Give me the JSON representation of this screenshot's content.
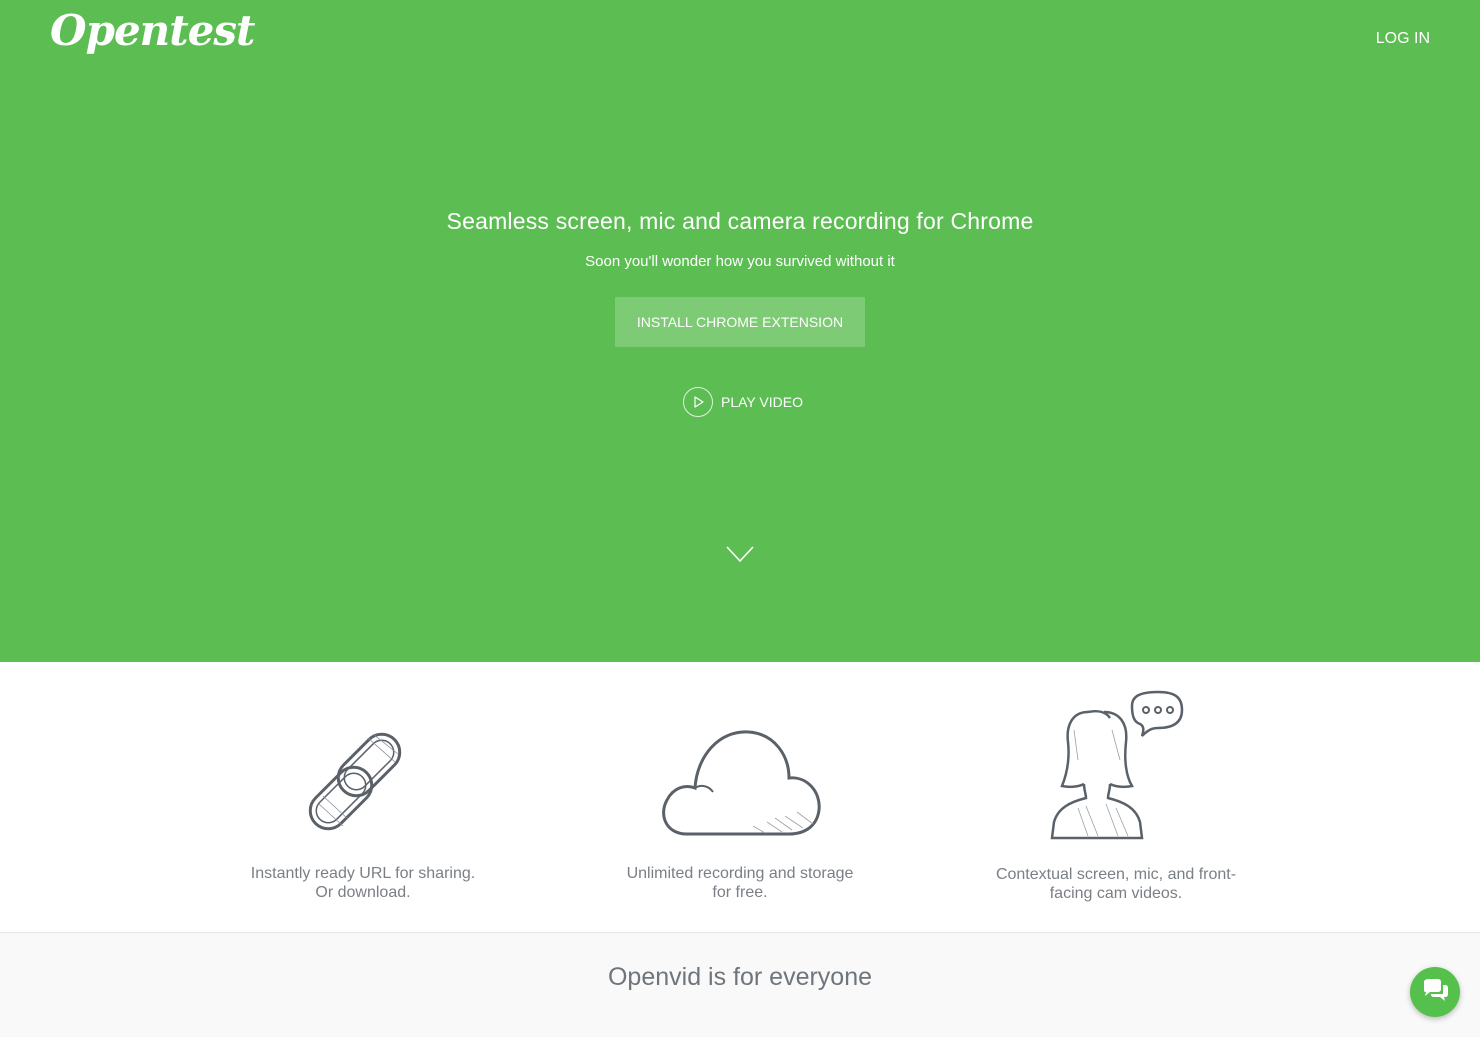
{
  "header": {
    "logo_text": "Opentest",
    "login_label": "LOG IN"
  },
  "hero": {
    "headline": "Seamless screen, mic and camera recording for Chrome",
    "subline": "Soon you'll wonder how you survived without it",
    "install_button_label": "INSTALL CHROME EXTENSION",
    "play_video_label": "PLAY VIDEO",
    "scroll_icon": "chevron-down-icon"
  },
  "features": [
    {
      "icon": "link-chain-icon",
      "line1": "Instantly ready URL for sharing.",
      "line2": "Or download."
    },
    {
      "icon": "cloud-icon",
      "line1": "Unlimited recording and storage",
      "line2": "for free."
    },
    {
      "icon": "person-speech-bubble-icon",
      "line1": "Contextual screen, mic, and front-",
      "line2": "facing cam videos."
    }
  ],
  "bottom": {
    "title": "Openvid is for everyone"
  },
  "chat": {
    "icon": "chat-bubbles-icon"
  },
  "colors": {
    "hero_green": "#5cbd53",
    "button_green": "#7dcb75",
    "text_gray": "#7a7f86"
  }
}
